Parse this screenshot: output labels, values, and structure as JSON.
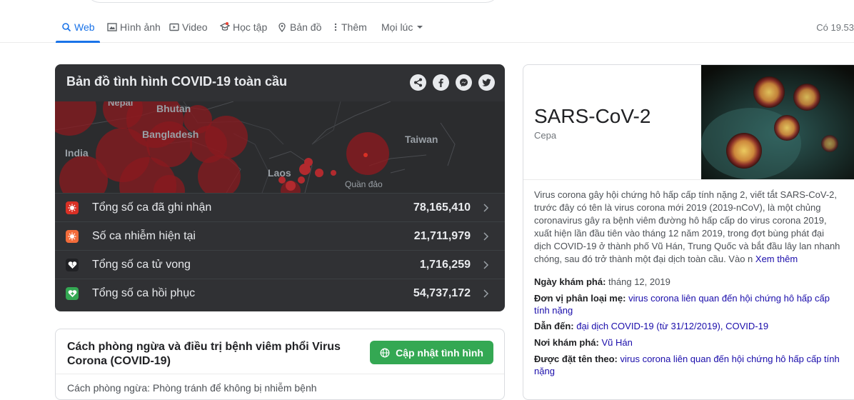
{
  "nav": {
    "items": [
      {
        "label": "Web",
        "icon": "search-icon"
      },
      {
        "label": "Hình ảnh",
        "icon": "image-icon"
      },
      {
        "label": "Video",
        "icon": "video-icon"
      },
      {
        "label": "Học tập",
        "icon": "graduation-cap-icon"
      },
      {
        "label": "Bản đồ",
        "icon": "map-pin-icon"
      },
      {
        "label": "Thêm",
        "icon": "more-vertical-icon"
      },
      {
        "label": "Mọi lúc",
        "icon": "caret-down-icon"
      }
    ],
    "result_count": "Có 19.53"
  },
  "covid": {
    "title": "Bản đồ tình hình COVID-19 toàn cầu",
    "share_icons": [
      "share-icon",
      "facebook-icon",
      "messenger-icon",
      "twitter-icon"
    ],
    "map_labels": [
      "Nepal",
      "Bhutan",
      "Bangladesh",
      "India",
      "Laos",
      "Taiwan",
      "Quần đảo"
    ],
    "stats": [
      {
        "label": "Tổng số ca đã ghi nhận",
        "value": "78,165,410",
        "icon": "virus-icon",
        "color": "#d93025"
      },
      {
        "label": "Số ca nhiễm hiện tại",
        "value": "21,711,979",
        "icon": "virus-icon",
        "color": "#f26b3a"
      },
      {
        "label": "Tổng số ca tử vong",
        "value": "1,716,259",
        "icon": "broken-heart-icon",
        "color": "#202124"
      },
      {
        "label": "Tổng số ca hồi phục",
        "value": "54,737,172",
        "icon": "heart-plus-icon",
        "color": "#34a853"
      }
    ]
  },
  "prevention": {
    "title": "Cách phòng ngừa và điều trị bệnh viêm phổi Virus Corona (COVID-19)",
    "button_label": "Cập nhật tình hình",
    "snippet": "Cách phòng ngừa: Phòng tránh để không bị nhiễm bệnh"
  },
  "knowledge_panel": {
    "title": "SARS-CoV-2",
    "subtitle": "Cepa",
    "description": "Virus corona gây hội chứng hô hấp cấp tính nặng 2, viết tắt SARS-CoV-2, trước đây có tên là virus corona mới 2019 (2019-nCoV), là một chủng coronavirus gây ra bệnh viêm đường hô hấp cấp do virus corona 2019, xuất hiện lần đầu tiên vào tháng 12 năm 2019, trong đợt bùng phát đại dịch COVID-19 ở thành phố Vũ Hán, Trung Quốc và bắt đầu lây lan nhanh chóng, sau đó trở thành một đại dịch toàn cầu. Vào n",
    "more_link": "Xem thêm",
    "facts": [
      {
        "label": "Ngày khám phá:",
        "value": "tháng 12, 2019",
        "is_link": false
      },
      {
        "label": "Đơn vị phân loại mẹ:",
        "value": "virus corona liên quan đến hội chứng hô hấp cấp tính nặng",
        "is_link": true
      },
      {
        "label": "Dẫn đến:",
        "value": "đại dịch COVID-19 (từ 31/12/2019), COVID-19",
        "is_link": true
      },
      {
        "label": "Nơi khám phá:",
        "value": "Vũ Hán",
        "is_link": true
      },
      {
        "label": "Được đặt tên theo:",
        "value": "virus corona liên quan đến hội chứng hô hấp cấp tính nặng",
        "is_link": true
      }
    ]
  }
}
